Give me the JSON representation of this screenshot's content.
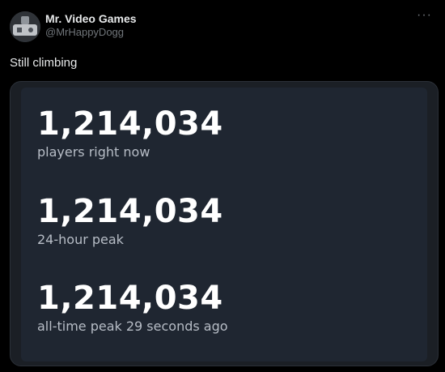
{
  "author": {
    "display_name": "Mr. Video Games",
    "handle": "@MrHappyDogg",
    "avatar_icon": "avatar-icon"
  },
  "more_icon": "more-options-icon",
  "tweet": {
    "text": "Still climbing"
  },
  "stats": [
    {
      "value": "1,214,034",
      "label": "players right now"
    },
    {
      "value": "1,214,034",
      "label": "24-hour peak"
    },
    {
      "value": "1,214,034",
      "label": "all-time peak 29 seconds ago"
    }
  ],
  "colors": {
    "background": "#000000",
    "card_background": "#1f2631",
    "media_background": "#1b1f25",
    "number_color": "#ffffff",
    "label_color": "#b7bdc6",
    "handle_color": "#71767b"
  }
}
